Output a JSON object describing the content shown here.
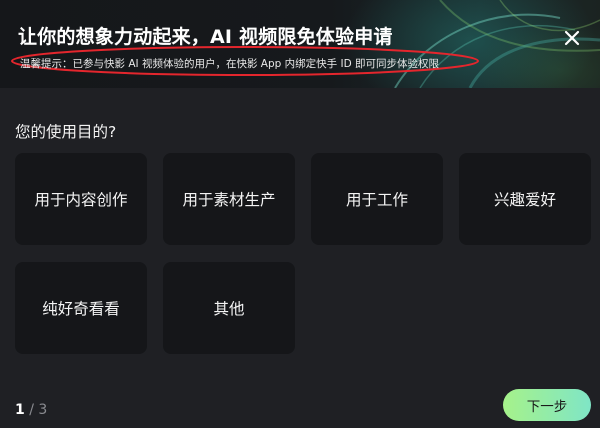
{
  "dialog": {
    "title": "让你的想象力动起来，AI 视频限免体验申请",
    "subtitle": "温馨提示：已参与快影 AI 视频体验的用户，在快影 App 内绑定快手 ID 即可同步体验权限",
    "accent_color": "#e4262d"
  },
  "question": {
    "title": "您的使用目的?"
  },
  "options": [
    {
      "label": "用于内容创作"
    },
    {
      "label": "用于素材生产"
    },
    {
      "label": "用于工作"
    },
    {
      "label": "兴趣爱好"
    },
    {
      "label": "纯好奇看看"
    },
    {
      "label": "其他"
    }
  ],
  "pager": {
    "current": "1",
    "separator": "/",
    "total": "3"
  },
  "next_button": {
    "label": "下一步"
  }
}
